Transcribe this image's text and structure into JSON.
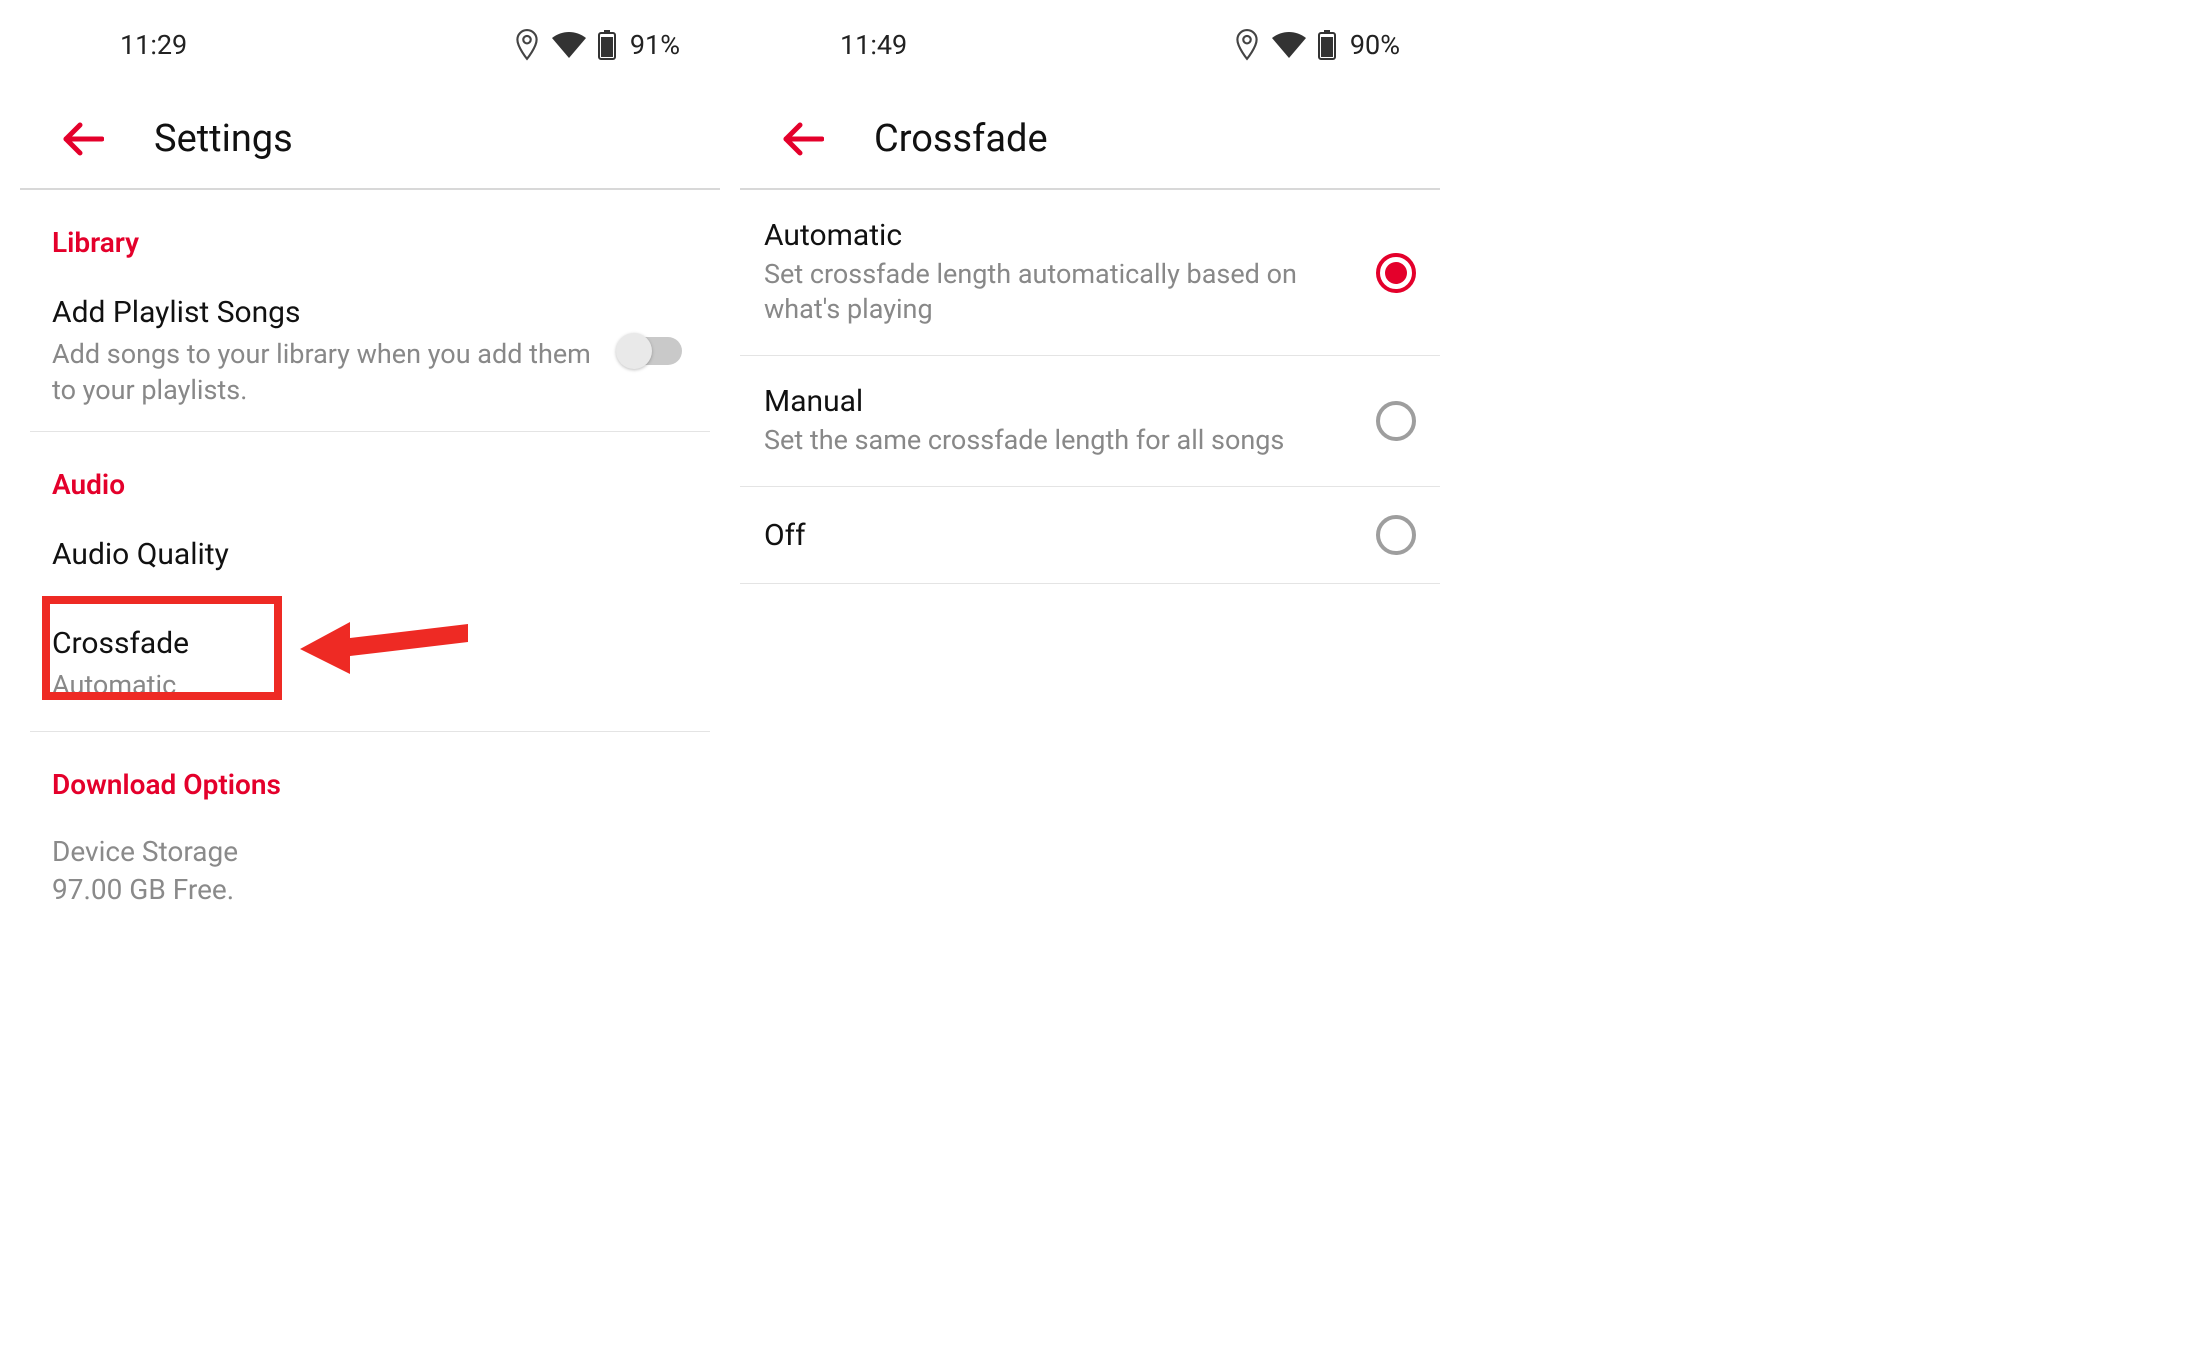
{
  "left": {
    "status": {
      "time": "11:29",
      "battery": "91%"
    },
    "title": "Settings",
    "sections": {
      "library": {
        "header": "Library",
        "addSongs": {
          "title": "Add Playlist Songs",
          "sub": "Add songs to your library when you add them to your playlists."
        }
      },
      "audio": {
        "header": "Audio",
        "quality": {
          "title": "Audio Quality"
        },
        "crossfade": {
          "title": "Crossfade",
          "sub": "Automatic"
        }
      },
      "download": {
        "header": "Download Options",
        "storage": {
          "title": "Device Storage",
          "sub": "97.00 GB Free."
        }
      }
    }
  },
  "right": {
    "status": {
      "time": "11:49",
      "battery": "90%"
    },
    "title": "Crossfade",
    "options": {
      "automatic": {
        "title": "Automatic",
        "sub": "Set crossfade length automatically based on what's playing"
      },
      "manual": {
        "title": "Manual",
        "sub": "Set the same crossfade length for all songs"
      },
      "off": {
        "title": "Off"
      }
    }
  }
}
